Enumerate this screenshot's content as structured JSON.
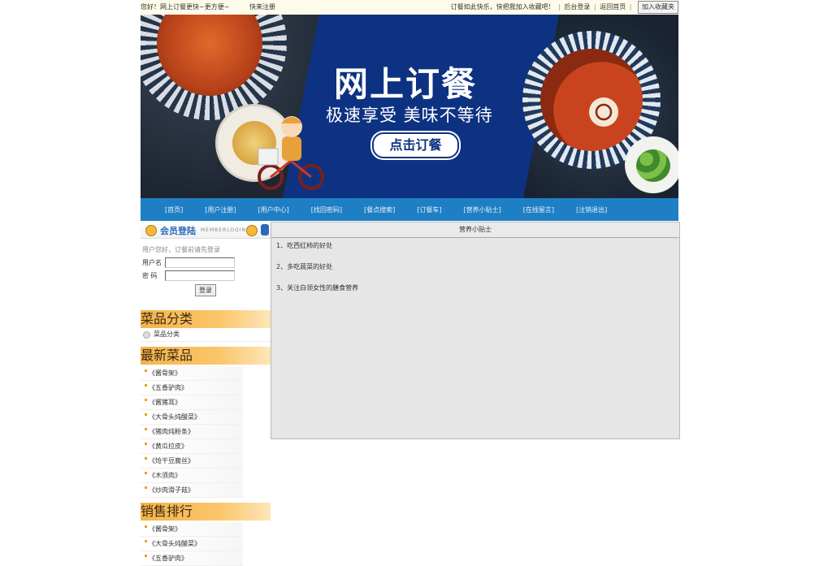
{
  "topbar": {
    "greeting": "您好！网上订餐更快~更方便~",
    "register": "快来注册",
    "welcome": "订餐如此快乐，快把我加入收藏吧！",
    "admin_login": "后台登录",
    "home_link": "返回首页",
    "favorite": "加入收藏夹"
  },
  "banner": {
    "title": "网上订餐",
    "subtitle": "极速享受 美味不等待",
    "cta": "点击订餐"
  },
  "nav": [
    "[首页]",
    "[用户注册]",
    "[用户中心]",
    "[找回密码]",
    "[餐点搜索]",
    "[订餐车]",
    "[营养小贴士]",
    "[在线留言]",
    "[注销退出]"
  ],
  "member": {
    "title": "会员登陆",
    "title_en": "MEMBERLOGIN",
    "hint": "用户您好，订餐前请先登录",
    "username_label": "用户名",
    "password_label": "密 码",
    "login_button": "登录"
  },
  "categories": {
    "title": "菜品分类",
    "items": [
      "菜品分类"
    ]
  },
  "newest": {
    "title": "最新菜品",
    "items": [
      "《酱骨架》",
      "《五香驴肉》",
      "《酱猪耳》",
      "《大骨头炖酸菜》",
      "《猪肉炖粉条》",
      "《黄瓜拉皮》",
      "《炝干豆腐丝》",
      "《木须肉》",
      "《炒肉滑子菇》"
    ]
  },
  "ranking": {
    "title": "销售排行",
    "items": [
      "《酱骨架》",
      "《大骨头炖酸菜》",
      "《五香驴肉》"
    ]
  },
  "main": {
    "header": "营养小贴士",
    "tips": [
      "1、吃西红柿的好处",
      "2、多吃蔬菜的好处",
      "3、关注白领女性的膳食营养"
    ]
  }
}
